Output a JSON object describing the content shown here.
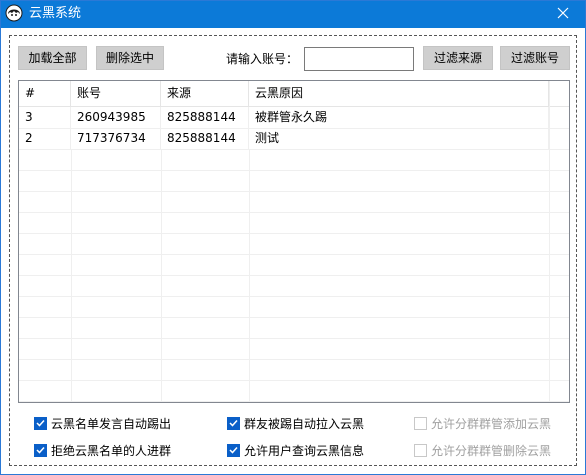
{
  "window": {
    "title": "云黑系统",
    "app_icon": "avatar-icon",
    "close_icon": "close-icon"
  },
  "toolbar": {
    "load_all": "加载全部",
    "delete_selected": "删除选中",
    "account_prompt": "请输入账号：",
    "account_value": "",
    "account_placeholder": "",
    "filter_source": "过滤来源",
    "filter_account": "过滤账号"
  },
  "table": {
    "columns": [
      "#",
      "账号",
      "来源",
      "云黑原因"
    ],
    "rows": [
      [
        "3",
        "260943985",
        "825888144",
        "被群管永久踢"
      ],
      [
        "2",
        "717376734",
        "825888144",
        "测试"
      ]
    ]
  },
  "options": {
    "row1": [
      {
        "label": "云黑名单发言自动踢出",
        "checked": true,
        "enabled": true
      },
      {
        "label": "群友被踢自动拉入云黑",
        "checked": true,
        "enabled": true
      },
      {
        "label": "允许分群群管添加云黑",
        "checked": false,
        "enabled": false
      }
    ],
    "row2": [
      {
        "label": "拒绝云黑名单的人进群",
        "checked": true,
        "enabled": true
      },
      {
        "label": "允许用户查询云黑信息",
        "checked": true,
        "enabled": true
      },
      {
        "label": "允许分群群管删除云黑",
        "checked": false,
        "enabled": false
      }
    ]
  },
  "colors": {
    "titlebar": "#0c7ad8",
    "checkbox_on": "#0a5fc8",
    "button": "#cfcfcf"
  }
}
